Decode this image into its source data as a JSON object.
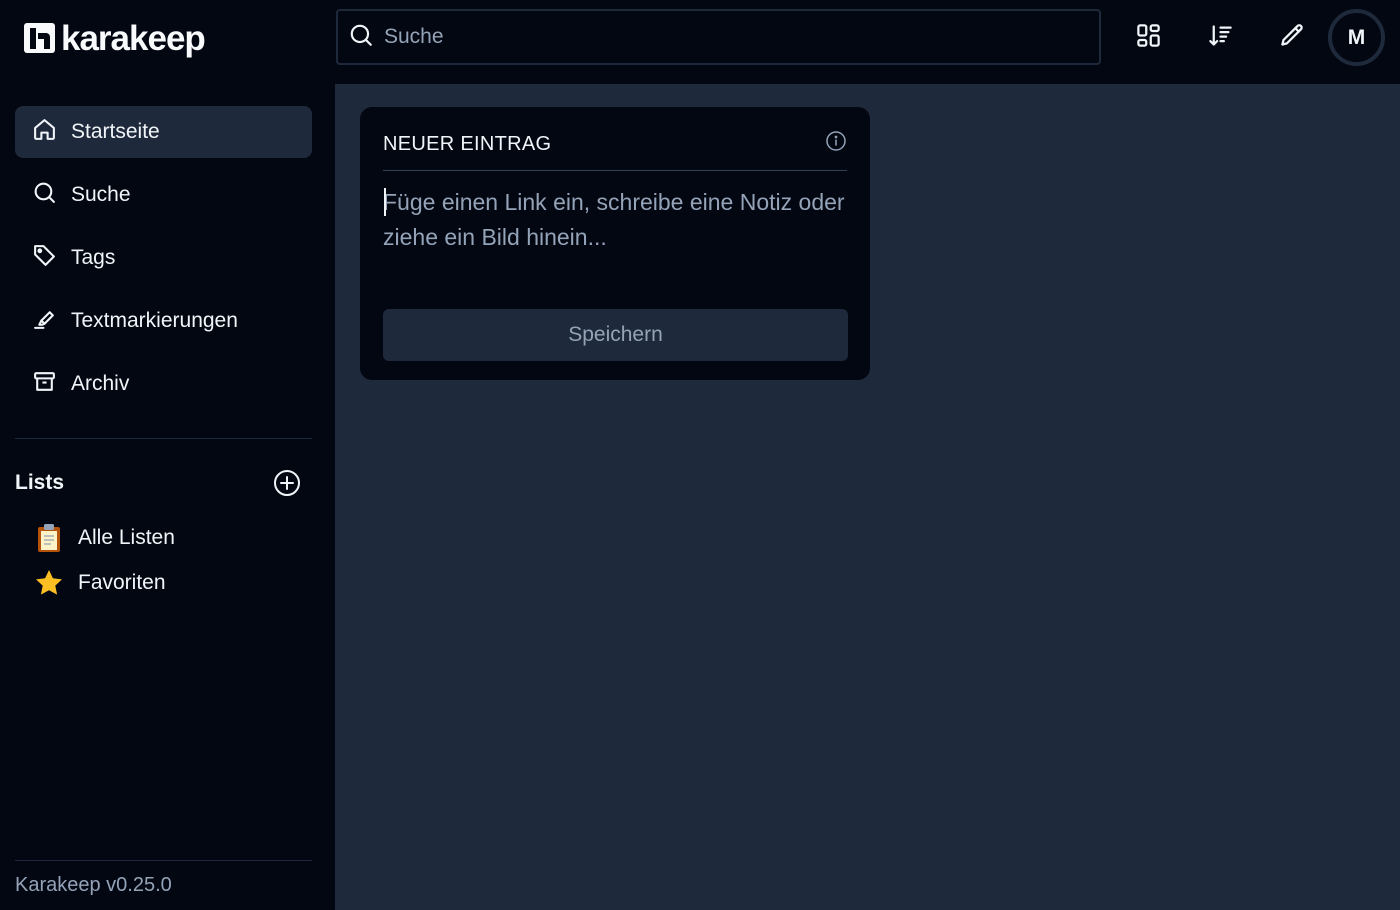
{
  "brand": {
    "name": "karakeep",
    "icon": "karakeep-logo-icon"
  },
  "sidebar": {
    "items": [
      {
        "label": "Startseite",
        "icon": "home-icon",
        "active": true
      },
      {
        "label": "Suche",
        "icon": "search-icon"
      },
      {
        "label": "Tags",
        "icon": "tag-icon"
      },
      {
        "label": "Textmarkierungen",
        "icon": "highlighter-icon"
      },
      {
        "label": "Archiv",
        "icon": "archive-icon"
      }
    ],
    "lists_title": "Lists",
    "lists": [
      {
        "label": "Alle Listen",
        "emoji": "📋"
      },
      {
        "label": "Favoriten",
        "emoji": "⭐"
      }
    ],
    "version": "Karakeep v0.25.0"
  },
  "header": {
    "search_placeholder": "Suche",
    "avatar_initial": "M",
    "icons": [
      "layout-grid-icon",
      "sort-descending-icon",
      "pencil-icon"
    ]
  },
  "editor": {
    "title": "NEUER EINTRAG",
    "placeholder": "Füge einen Link ein, schreibe eine Notiz oder ziehe ein Bild hinein...",
    "save_label": "Speichern"
  },
  "colors": {
    "sidebar_bg": "#030712",
    "main_bg": "#1e293b",
    "text": "#f1f5f9",
    "muted": "#94a3b8"
  }
}
